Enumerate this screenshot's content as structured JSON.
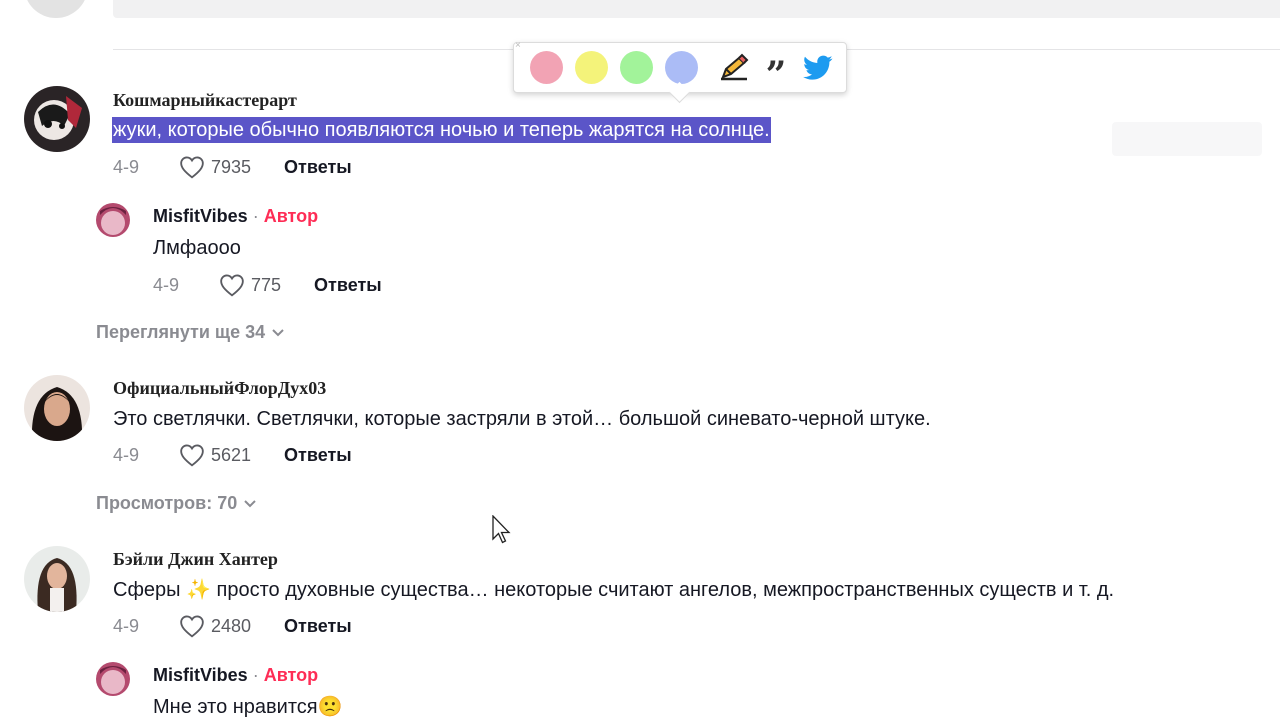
{
  "toolbar": {
    "close": "×",
    "swatches": [
      {
        "name": "pink",
        "color": "#f2a3b4"
      },
      {
        "name": "yellow",
        "color": "#f4f37a"
      },
      {
        "name": "green",
        "color": "#a2f39a"
      },
      {
        "name": "blue",
        "color": "#abbcf6"
      }
    ],
    "quote": "”"
  },
  "comments": [
    {
      "username": "Кошмарныйкастерарт",
      "text": "жуки, которые обычно появляются ночью и теперь жарятся на солнце.",
      "date": "4-9",
      "likes": "7935",
      "reply": "Ответы",
      "replies": [
        {
          "username": "MisfitVibes",
          "separator": " · ",
          "tag": "Автор",
          "text": "Лмфаооо",
          "date": "4-9",
          "likes": "775",
          "reply": "Ответы"
        }
      ],
      "view_more": "Переглянути ще 34"
    },
    {
      "username": "ОфициальныйФлорДух03",
      "text": "Это светлячки. Светлячки, которые застряли в этой… большой синевато-черной штуке.",
      "date": "4-9",
      "likes": "5621",
      "reply": "Ответы",
      "view_more": "Просмотров: 70"
    },
    {
      "username": "Бэйли Джин Хантер",
      "text_before": "Сферы ",
      "emoji": "✨",
      "text_after": " просто духовные существа… некоторые считают ангелов, межпространственных существ и т. д.",
      "date": "4-9",
      "likes": "2480",
      "reply": "Ответы",
      "replies": [
        {
          "username": "MisfitVibes",
          "separator": " · ",
          "tag": "Автор",
          "text": "Мне это нравится",
          "emoji": "🙁"
        }
      ]
    }
  ],
  "colors": {
    "selection": "#5b55c8",
    "author": "#fe2c55",
    "muted": "#8a8b91"
  }
}
